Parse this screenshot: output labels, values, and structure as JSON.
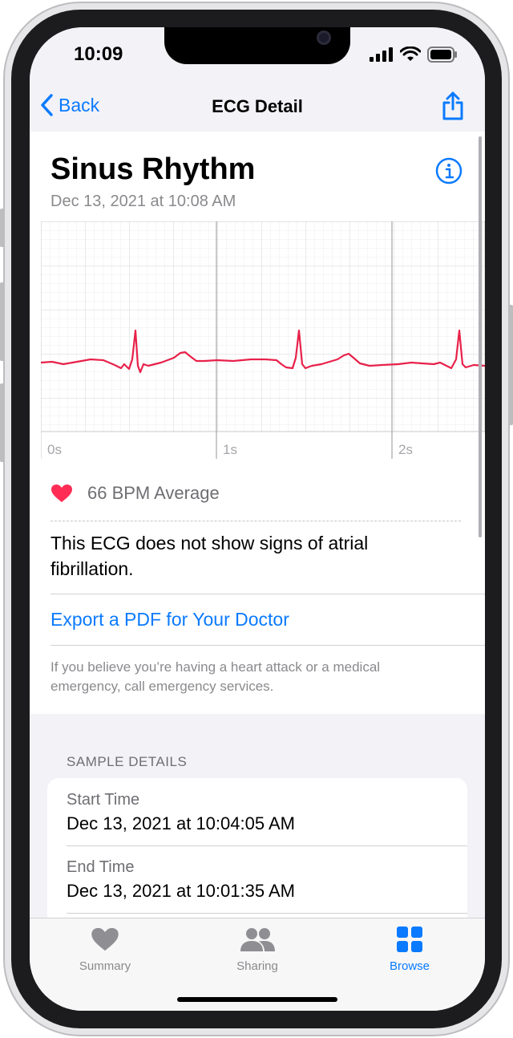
{
  "status": {
    "time": "10:09"
  },
  "nav": {
    "back_label": "Back",
    "title": "ECG Detail"
  },
  "ecg": {
    "rhythm": "Sinus Rhythm",
    "date": "Dec 13, 2021 at 10:08 AM",
    "time_labels": [
      "0s",
      "1s",
      "2s"
    ],
    "line_color": "#e8214a",
    "bpm_text": "66 BPM Average",
    "summary": "This ECG does not show signs of atrial fibrillation.",
    "export_label": "Export a PDF for Your Doctor",
    "disclaimer": "If you believe you’re having a heart attack or a medical emergency, call emergency services."
  },
  "sample_details": {
    "header": "SAMPLE DETAILS",
    "items": [
      {
        "label": "Start Time",
        "value": "Dec 13, 2021 at 10:04:05 AM"
      },
      {
        "label": "End Time",
        "value": "Dec 13, 2021 at 10:01:35 AM"
      }
    ]
  },
  "tabs": [
    {
      "label": "Summary",
      "icon": "heart-icon",
      "active": false
    },
    {
      "label": "Sharing",
      "icon": "people-icon",
      "active": false
    },
    {
      "label": "Browse",
      "icon": "grid-icon",
      "active": true
    }
  ],
  "colors": {
    "accent": "#0a7aff",
    "heart": "#ff2d55"
  }
}
